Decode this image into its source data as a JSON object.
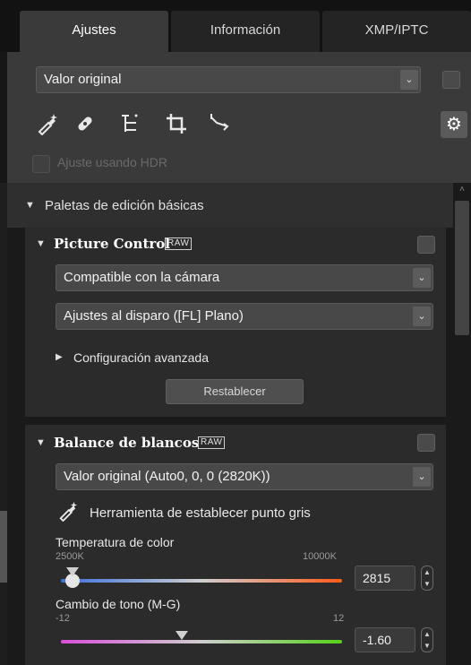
{
  "tabs": [
    {
      "label": "Ajustes",
      "active": true
    },
    {
      "label": "Información",
      "active": false
    },
    {
      "label": "XMP/IPTC",
      "active": false
    }
  ],
  "preset": {
    "value": "Valor original"
  },
  "tools": [
    {
      "icon": "eyedropper-sparkle-icon"
    },
    {
      "icon": "retouch-brush-icon"
    },
    {
      "icon": "levels-tree-icon"
    },
    {
      "icon": "crop-icon"
    },
    {
      "icon": "straighten-icon"
    }
  ],
  "settings_icon": "gear-icon",
  "hdr": {
    "label": "Ajuste usando HDR",
    "checked": false
  },
  "palette": {
    "title": "Paletas de edición básicas"
  },
  "picture_control": {
    "title": "Picture Control",
    "badge": "RAW",
    "mode": "Compatible con la cámara",
    "preset": "Ajustes al disparo ([FL] Plano)",
    "advanced": "Configuración avanzada",
    "reset": "Restablecer"
  },
  "white_balance": {
    "title": "Balance de blancos",
    "badge": "RAW",
    "mode": "Valor original (Auto0, 0, 0 (2820K))",
    "gray_point_tool": "Herramienta de establecer punto gris",
    "temperature": {
      "label": "Temperatura de color",
      "min": "2500K",
      "max": "10000K",
      "value": "2815",
      "fraction": 0.04
    },
    "tint": {
      "label": "Cambio de tono (M-G)",
      "min": "-12",
      "max": "12",
      "value": "-1.60",
      "fraction": 0.43
    }
  }
}
